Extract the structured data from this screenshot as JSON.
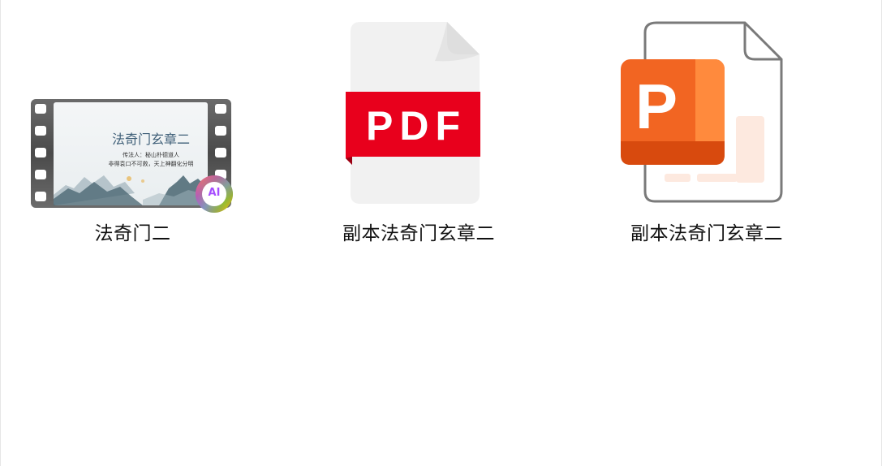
{
  "files": [
    {
      "name": "法奇门二",
      "type": "video",
      "icon": "video-film-icon",
      "thumbnail": {
        "title": "法奇门玄章二",
        "line1": "传法人：秘山朴德道人",
        "line2": "非得袁口不可救，天上神翻化分明"
      },
      "badge": "AI"
    },
    {
      "name": "副本法奇门玄章二",
      "type": "pdf",
      "icon": "pdf-file-icon",
      "badge_text": "PDF",
      "color": "#e8001c"
    },
    {
      "name": "副本法奇门玄章二",
      "type": "pptx",
      "icon": "powerpoint-file-icon",
      "badge_text": "P",
      "color": "#f26522"
    }
  ]
}
